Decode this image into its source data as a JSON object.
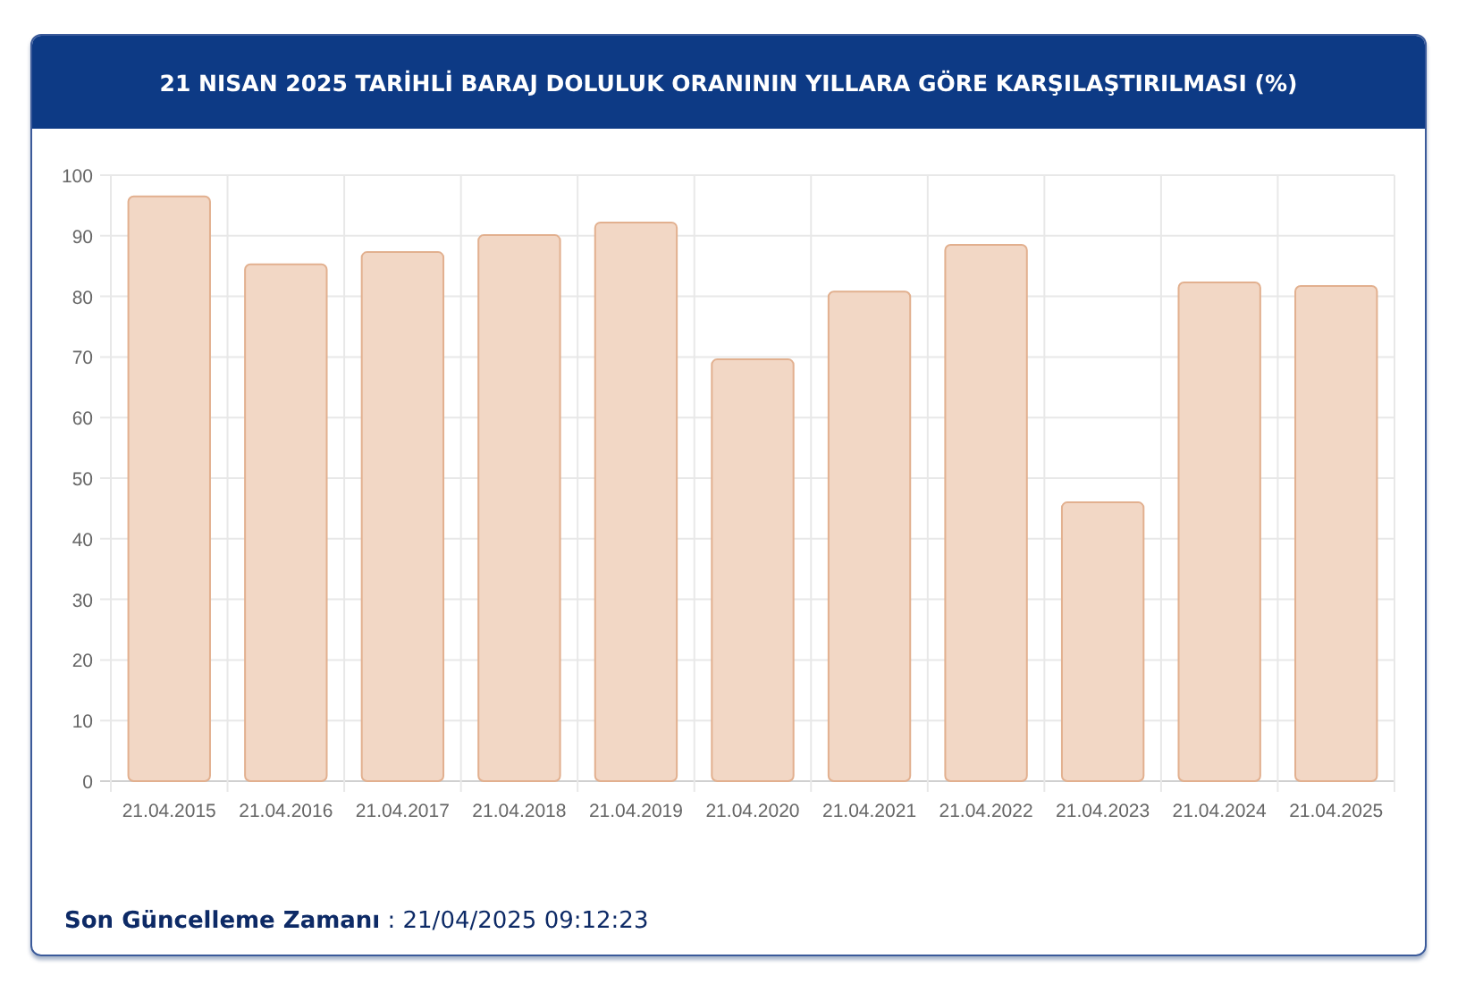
{
  "header": {
    "title": "21 NISAN 2025 TARİHLİ BARAJ DOLULUK ORANININ YILLARA GÖRE KARŞILAŞTIRILMASI (%)"
  },
  "chart": {
    "chart_data": {
      "type": "bar",
      "categories": [
        "21.04.2015",
        "21.04.2016",
        "21.04.2017",
        "21.04.2018",
        "21.04.2019",
        "21.04.2020",
        "21.04.2021",
        "21.04.2022",
        "21.04.2023",
        "21.04.2024",
        "21.04.2025"
      ],
      "values": [
        96.5,
        85.3,
        87.3,
        90.1,
        92.2,
        69.6,
        80.8,
        88.5,
        46.0,
        82.3,
        81.7
      ],
      "ylim": [
        0,
        100
      ],
      "yticks": [
        0,
        10,
        20,
        30,
        40,
        50,
        60,
        70,
        80,
        90,
        100
      ],
      "grid": true
    }
  },
  "footer": {
    "text": "**Son Güncelleme Zamanı** : 21/04/2025 09:12:23"
  }
}
